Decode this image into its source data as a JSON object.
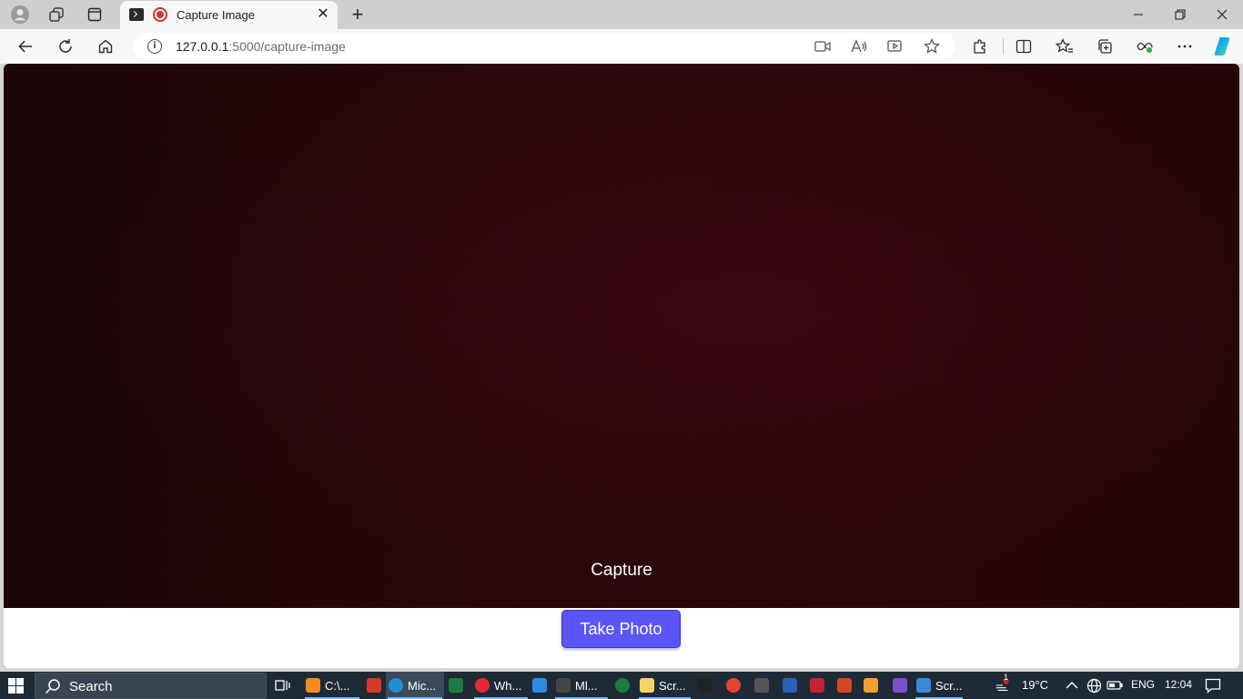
{
  "browser": {
    "tab": {
      "title": "Capture Image",
      "close_glyph": "✕"
    },
    "new_tab_glyph": "+",
    "window_controls": {
      "minimize": "—",
      "restore": "❐",
      "close": "✕"
    },
    "address": {
      "host": "127.0.0.1",
      "rest": ":5000/capture-image"
    },
    "toolbar_icons": [
      "back-icon",
      "refresh-icon",
      "home-icon",
      "camera-permission-icon",
      "read-aloud-icon",
      "immersive-reader-icon",
      "favorite-star-icon",
      "extensions-icon",
      "split-screen-icon",
      "favorites-icon",
      "collections-icon",
      "browser-essentials-icon",
      "more-icon",
      "copilot-icon"
    ]
  },
  "page": {
    "video_overlay_label": "Capture",
    "take_photo_label": "Take Photo",
    "button_color": "#5b55f5"
  },
  "taskbar": {
    "search_label": "Search",
    "apps": [
      {
        "label": "C:\\...",
        "icon": "sublime-icon",
        "color": "#f28b1e"
      },
      {
        "label": "",
        "icon": "app-grid-icon",
        "color": "#d6382c"
      },
      {
        "label": "Mic...",
        "icon": "edge-icon",
        "color": "#1f8fd6"
      },
      {
        "label": "",
        "icon": "excel-icon",
        "color": "#1d7a45"
      },
      {
        "label": "Wh...",
        "icon": "opera-icon",
        "color": "#e22a35"
      },
      {
        "label": "",
        "icon": "mail-icon",
        "color": "#2d8ae0"
      },
      {
        "label": "Ml...",
        "icon": "terminal-icon",
        "color": "#444444"
      },
      {
        "label": "",
        "icon": "spinner-icon",
        "color": "#1e7a3e"
      },
      {
        "label": "Scr...",
        "icon": "notes-icon",
        "color": "#f5d463"
      },
      {
        "label": "",
        "icon": "7zip-icon",
        "color": "#222222"
      },
      {
        "label": "",
        "icon": "chrome-icon",
        "color": "#e84335"
      },
      {
        "label": "",
        "icon": "keyboard-icon",
        "color": "#555555"
      },
      {
        "label": "",
        "icon": "word-icon",
        "color": "#2b5fb8"
      },
      {
        "label": "",
        "icon": "game-icon",
        "color": "#c4232f"
      },
      {
        "label": "",
        "icon": "powerpoint-icon",
        "color": "#d24726"
      },
      {
        "label": "",
        "icon": "git-icon",
        "color": "#f0a030"
      },
      {
        "label": "",
        "icon": "vs-icon",
        "color": "#7b4fc9"
      },
      {
        "label": "Scr...",
        "icon": "screenshot-icon",
        "color": "#3a8ad6"
      }
    ],
    "tray": {
      "weather": "19°C",
      "weather_badge": "1",
      "language": "ENG",
      "time": "12:04"
    }
  }
}
